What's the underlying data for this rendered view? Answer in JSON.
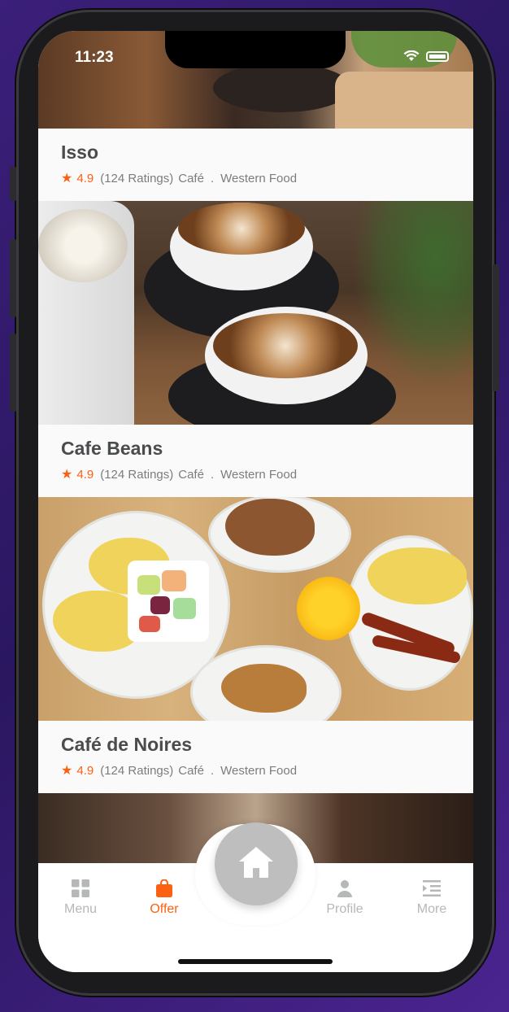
{
  "status_bar": {
    "time": "11:23"
  },
  "restaurants": [
    {
      "name": "Isso",
      "rating": "4.9",
      "ratings_count": "(124 Ratings)",
      "type": "Café",
      "separator": ".",
      "cuisine": "Western Food"
    },
    {
      "name": "Cafe Beans",
      "rating": "4.9",
      "ratings_count": "(124 Ratings)",
      "type": "Café",
      "separator": ".",
      "cuisine": "Western Food"
    },
    {
      "name": "Café de Noires",
      "rating": "4.9",
      "ratings_count": "(124 Ratings)",
      "type": "Café",
      "separator": ".",
      "cuisine": "Western Food"
    }
  ],
  "tab_bar": {
    "tabs": [
      {
        "label": "Menu",
        "icon": "grid-icon",
        "active": false
      },
      {
        "label": "Offer",
        "icon": "shopping-bag-icon",
        "active": true
      },
      {
        "label": "Profile",
        "icon": "person-icon",
        "active": false
      },
      {
        "label": "More",
        "icon": "menu-indent-icon",
        "active": false
      }
    ],
    "center_icon": "home-icon"
  },
  "colors": {
    "accent": "#fc6011",
    "inactive": "#b6b7b7",
    "title": "#4a4b4d",
    "meta": "#7c7d7e"
  }
}
